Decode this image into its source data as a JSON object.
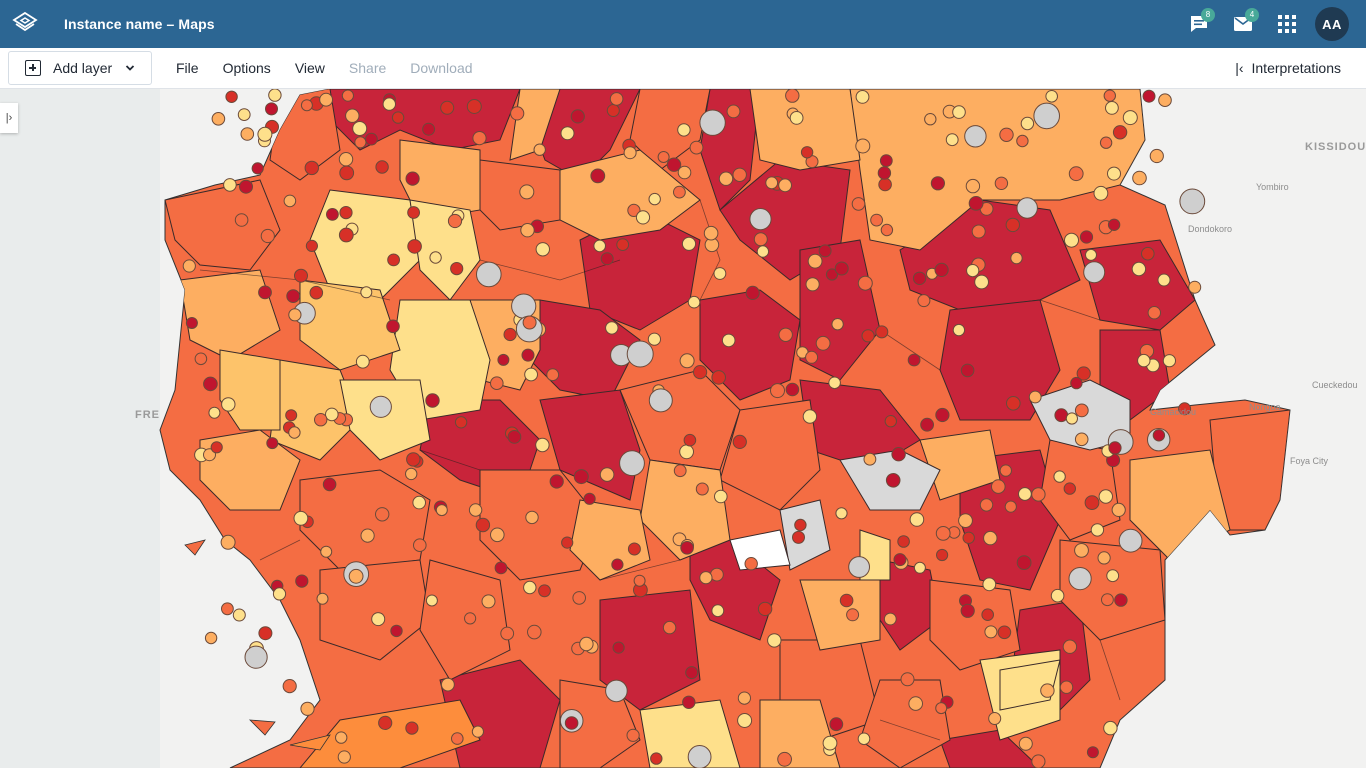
{
  "header": {
    "title": "Instance name – Maps",
    "interpretations_badge": "8",
    "messages_badge": "4",
    "avatar_initials": "AA",
    "color": "#2c6693"
  },
  "toolbar": {
    "add_layer": "Add layer",
    "file": "File",
    "options": "Options",
    "view": "View",
    "share": "Share",
    "download": "Download",
    "interpretations": "Interpretations"
  },
  "map": {
    "places": [
      "KISSIDOU",
      "Yombiro",
      "Dondokoro",
      "Cueckedou",
      "Nongoa",
      "Gamacidou",
      "Foya City",
      "FRE"
    ],
    "choropleth_colors": [
      "#fee08b",
      "#fdae61",
      "#f46d43",
      "#d73027",
      "#c8243a"
    ],
    "point_colors": [
      "#fee08b",
      "#fdae61",
      "#f46d43",
      "#d73027",
      "#c0152f",
      "#cfcfcf"
    ]
  }
}
